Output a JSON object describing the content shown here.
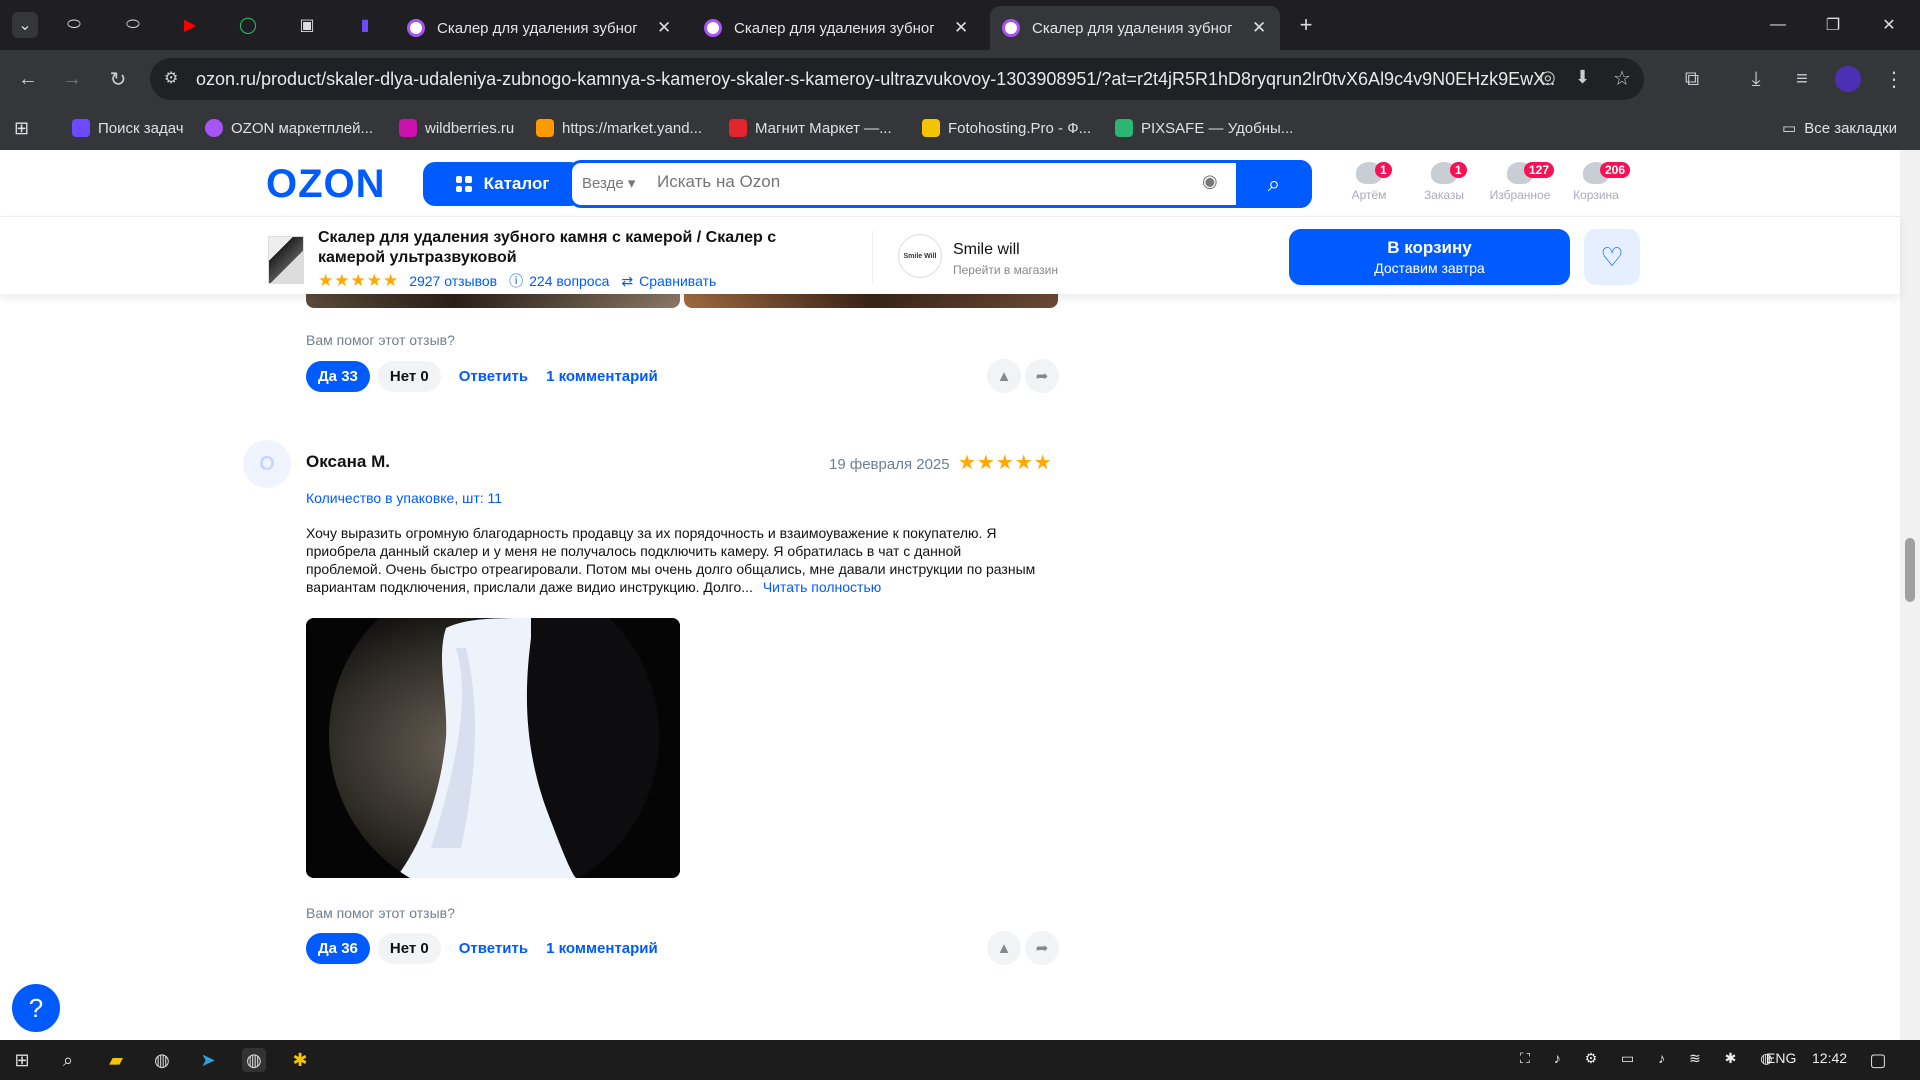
{
  "browser": {
    "tabs": [
      {
        "title": "Скалер для удаления зубного"
      },
      {
        "title": "Скалер для удаления зубного"
      },
      {
        "title": "Скалер для удаления зубного"
      }
    ],
    "url": "ozon.ru/product/skaler-dlya-udaleniya-zubnogo-kamnya-s-kameroy-skaler-s-kameroy-ultrazvukovoy-1303908951/?at=r2t4jR5R1hD8ryqrun2lr0tvX6Al9c4v9N0EHzk9EwX...",
    "bookmarks": [
      {
        "label": "Поиск задач",
        "color": "#6d4aff"
      },
      {
        "label": "OZON маркетплей...",
        "color": "#a855f7"
      },
      {
        "label": "wildberries.ru",
        "color": "#cb11ab"
      },
      {
        "label": "https://market.yand...",
        "color": "#ff9900"
      },
      {
        "label": "Магнит Маркет —...",
        "color": "#e3262e"
      },
      {
        "label": "Fotohosting.Pro - Ф...",
        "color": "#f5c400"
      },
      {
        "label": "PIXSAFE — Удобны...",
        "color": "#2bb673"
      }
    ],
    "all_bookmarks": "Все закладки"
  },
  "header": {
    "logo": "OZON",
    "catalog": "Каталог",
    "search_scope": "Везде",
    "search_placeholder": "Искать на Ozon",
    "items": [
      {
        "label": "Артём",
        "count": "1"
      },
      {
        "label": "Заказы",
        "count": "1"
      },
      {
        "label": "Избранное",
        "count": "127"
      },
      {
        "label": "Корзина",
        "count": "206"
      }
    ]
  },
  "product": {
    "title": "Скалер для удаления зубного камня с камерой / Скалер с камерой ультразвуковой",
    "rating_stars": "★★★★★",
    "reviews": "2927 отзывов",
    "questions": "224 вопроса",
    "compare": "Сравнивать",
    "seller_logo": "Smile Will",
    "seller_name": "Smile will",
    "seller_sub": "Перейти в магазин",
    "cart_label": "В корзину",
    "cart_sub": "Доставим завтра"
  },
  "review_prev": {
    "helpful_q": "Вам помог этот отзыв?",
    "yes": "Да 33",
    "no": "Нет 0",
    "reply": "Ответить",
    "comments": "1 комментарий"
  },
  "review": {
    "avatar_letter": "О",
    "author": "Оксана М.",
    "date": "19 февраля 2025",
    "stars": "★★★★★",
    "variant": "Количество в упаковке, шт: 11",
    "text": "Хочу выразить огромную благодарность продавцу за их порядочность и взаимоуважение к покупателю. Я приобрела данный скалер и у меня не получалось подключить камеру. Я обратилась в чат с данной проблемой. Очень быстро отреагировали. Потом мы очень долго общались, мне давали инструкции по разным вариантам подключения, прислали даже видио инструкцию. Долго...",
    "read_more": "Читать полностью",
    "helpful_q": "Вам помог этот отзыв?",
    "yes": "Да 36",
    "no": "Нет 0",
    "reply": "Ответить",
    "comments": "1 комментарий"
  },
  "taskbar": {
    "lang": "ENG",
    "time": "12:42"
  }
}
